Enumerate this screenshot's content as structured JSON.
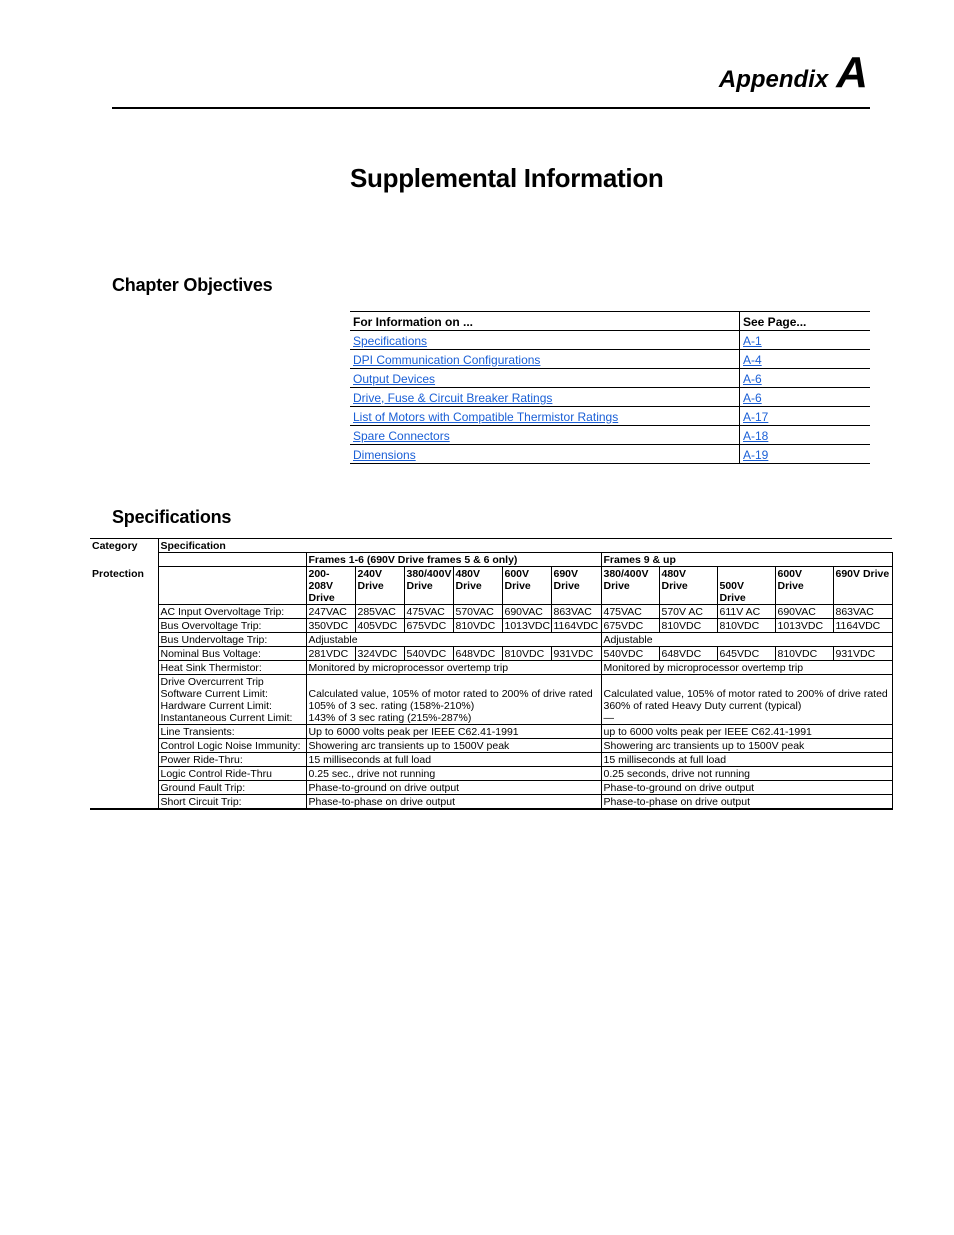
{
  "header": {
    "appendix_word": "Appendix",
    "appendix_letter": "A"
  },
  "page_title": "Supplemental Information",
  "sections": {
    "objectives_heading": "Chapter Objectives",
    "specifications_heading": "Specifications"
  },
  "toc": {
    "col_info": "For Information on ...",
    "col_page": "See Page...",
    "link_color": "#1a5fd6",
    "rows": [
      {
        "label": "Specifications",
        "page": "A-1"
      },
      {
        "label": "DPI Communication Configurations",
        "page": "A-4"
      },
      {
        "label": "Output Devices",
        "page": "A-6"
      },
      {
        "label": "Drive, Fuse & Circuit Breaker Ratings",
        "page": "A-6"
      },
      {
        "label": "List of Motors with Compatible Thermistor Ratings",
        "page": "A-17"
      },
      {
        "label": "Spare Connectors",
        "page": "A-18"
      },
      {
        "label": "Dimensions",
        "page": "A-19"
      }
    ]
  },
  "spec_table": {
    "col_category": "Category",
    "col_specification": "Specification",
    "group_frames_1_6": "Frames 1-6 (690V Drive frames 5 & 6 only)",
    "group_frames_9_up": "Frames 9 & up",
    "category": "Protection",
    "drives_1_6": [
      "200-208V Drive",
      "240V Drive",
      "380/400V Drive",
      "480V Drive",
      "600V Drive",
      "690V Drive"
    ],
    "drives_9_up": [
      "380/400V Drive",
      "480V Drive",
      "500V Drive",
      "600V Drive",
      "690V Drive"
    ],
    "ac_input_overvoltage": {
      "label": "AC Input Overvoltage Trip:",
      "f16": [
        "247VAC",
        "285VAC",
        "475VAC",
        "570VAC",
        "690VAC",
        "863VAC"
      ],
      "f9": [
        "475VAC",
        "570V AC",
        "611V AC",
        "690VAC",
        "863VAC"
      ]
    },
    "bus_overvoltage": {
      "label": "Bus Overvoltage Trip:",
      "f16": [
        "350VDC",
        "405VDC",
        "675VDC",
        "810VDC",
        "1013VDC",
        "1164VDC"
      ],
      "f9": [
        "675VDC",
        "810VDC",
        "810VDC",
        "1013VDC",
        "1164VDC"
      ]
    },
    "bus_undervoltage": {
      "label": "Bus Undervoltage Trip:",
      "f16": "Adjustable",
      "f9": "Adjustable"
    },
    "nominal_bus": {
      "label": "Nominal Bus Voltage:",
      "f16": [
        "281VDC",
        "324VDC",
        "540VDC",
        "648VDC",
        "810VDC",
        "931VDC"
      ],
      "f9": [
        "540VDC",
        "648VDC",
        "645VDC",
        "810VDC",
        "931VDC"
      ]
    },
    "heat_sink": {
      "label": "Heat Sink Thermistor:",
      "f16": "Monitored by microprocessor overtemp trip",
      "f9": "Monitored by microprocessor overtemp trip"
    },
    "overcurrent": {
      "labels": [
        "Drive Overcurrent Trip",
        "Software Current Limit:",
        "Hardware Current Limit:",
        "Instantaneous Current Limit:"
      ],
      "f16": [
        "Calculated value, 105% of motor rated to 200% of drive rated",
        "105% of 3 sec. rating (158%-210%)",
        "143% of 3 sec rating (215%-287%)"
      ],
      "f9": [
        "Calculated value, 105% of motor rated to 200% of drive rated",
        "360% of rated Heavy Duty current (typical)",
        "—"
      ]
    },
    "simple_rows": [
      {
        "label": "Line Transients:",
        "f16": "Up to 6000 volts peak per IEEE C62.41-1991",
        "f9": "up to 6000 volts peak per IEEE C62.41-1991"
      },
      {
        "label": "Control Logic Noise Immunity:",
        "f16": "Showering arc transients up to 1500V peak",
        "f9": "Showering arc transients up to 1500V peak"
      },
      {
        "label": "Power Ride-Thru:",
        "f16": "15 milliseconds at full load",
        "f9": "15 milliseconds at full load"
      },
      {
        "label": "Logic Control Ride-Thru",
        "f16": "0.25 sec., drive not running",
        "f9": "0.25 seconds, drive not running"
      },
      {
        "label": "Ground Fault Trip:",
        "f16": "Phase-to-ground on drive output",
        "f9": "Phase-to-ground on drive output"
      },
      {
        "label": "Short Circuit Trip:",
        "f16": "Phase-to-phase on drive output",
        "f9": "Phase-to-phase on drive output"
      }
    ]
  }
}
